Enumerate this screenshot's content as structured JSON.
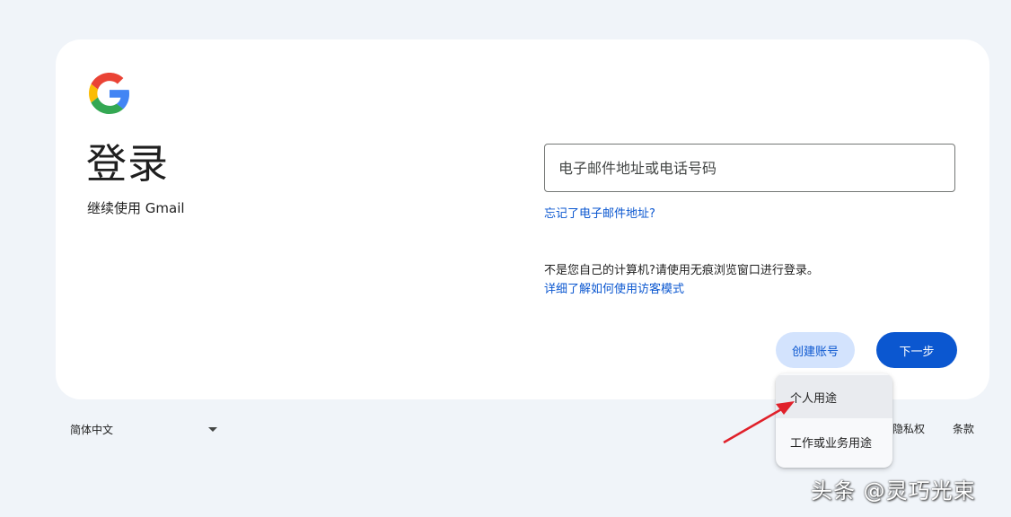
{
  "login": {
    "title": "登录",
    "subtitle": "继续使用 Gmail",
    "email_placeholder": "电子邮件地址或电话号码",
    "forgot_email": "忘记了电子邮件地址?",
    "notice": "不是您自己的计算机?请使用无痕浏览窗口进行登录。",
    "guest_mode_link": "详细了解如何使用访客模式",
    "create_account": "创建账号",
    "next": "下一步"
  },
  "account_menu": {
    "items": [
      "个人用途",
      "工作或业务用途"
    ]
  },
  "footer": {
    "language": "简体中文",
    "privacy": "隐私权",
    "terms": "条款"
  },
  "watermark": "头条 @灵巧光束",
  "colors": {
    "primary": "#0b57d0",
    "secondary_button": "#d3e3fd",
    "background": "#f0f4f9",
    "annotation_arrow": "#e0202a"
  },
  "icons": {
    "logo": "google-g-logo",
    "language_caret": "caret-down-icon",
    "annotation": "red-arrow"
  }
}
